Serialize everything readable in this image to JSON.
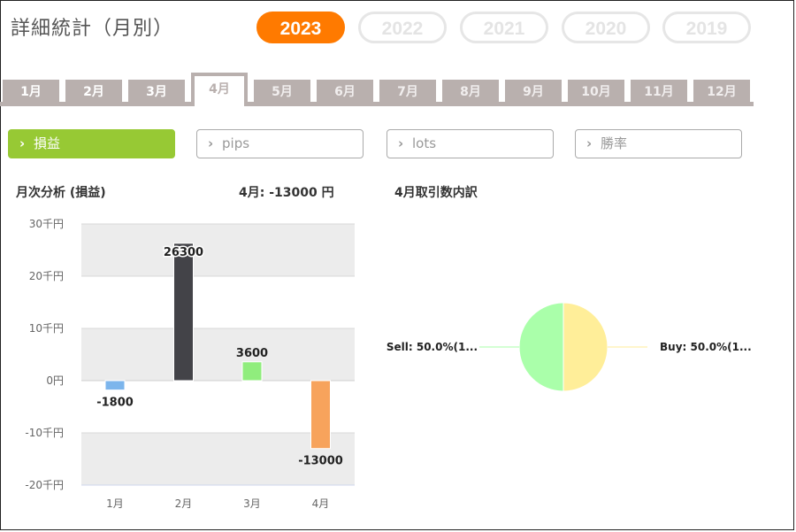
{
  "header": {
    "title": "詳細統計（月別）",
    "years": [
      "2023",
      "2022",
      "2021",
      "2020",
      "2019"
    ],
    "active_year": "2023"
  },
  "months": {
    "tabs": [
      "1月",
      "2月",
      "3月",
      "4月",
      "5月",
      "6月",
      "7月",
      "8月",
      "9月",
      "10月",
      "11月",
      "12月"
    ],
    "active": "4月"
  },
  "metrics": {
    "buttons": [
      "損益",
      "pips",
      "lots",
      "勝率"
    ],
    "active": "損益"
  },
  "summary": {
    "chart_title": "月次分析 (損益)",
    "current_label": "4月: -13000 円",
    "pie_title": "4月取引数内訳"
  },
  "colors": {
    "accent": "#ff7a00",
    "metric_active": "#97c934",
    "tab_gray": "#b9b0ae"
  },
  "chart_data": [
    {
      "type": "bar",
      "categories": [
        "1月",
        "2月",
        "3月",
        "4月"
      ],
      "values": [
        -1800,
        26300,
        3600,
        -13000
      ],
      "data_labels": [
        "-1800",
        "26300",
        "3600",
        "-13000"
      ],
      "colors": [
        "#7cb5ec",
        "#434348",
        "#90ed7d",
        "#f7a35c"
      ],
      "ylim": [
        -20000,
        30000
      ],
      "y_ticks": [
        30000,
        20000,
        10000,
        0,
        -10000,
        -20000
      ],
      "y_tick_labels": [
        "30千円",
        "20千円",
        "10千円",
        "0円",
        "-10千円",
        "-20千円"
      ],
      "xlabel": "",
      "ylabel": ""
    },
    {
      "type": "pie",
      "labels": [
        "Sell: 50.0%(1...",
        "Buy: 50.0%(1..."
      ],
      "values": [
        50,
        50
      ],
      "colors": [
        "#aaffaa",
        "#ffee99"
      ]
    }
  ]
}
